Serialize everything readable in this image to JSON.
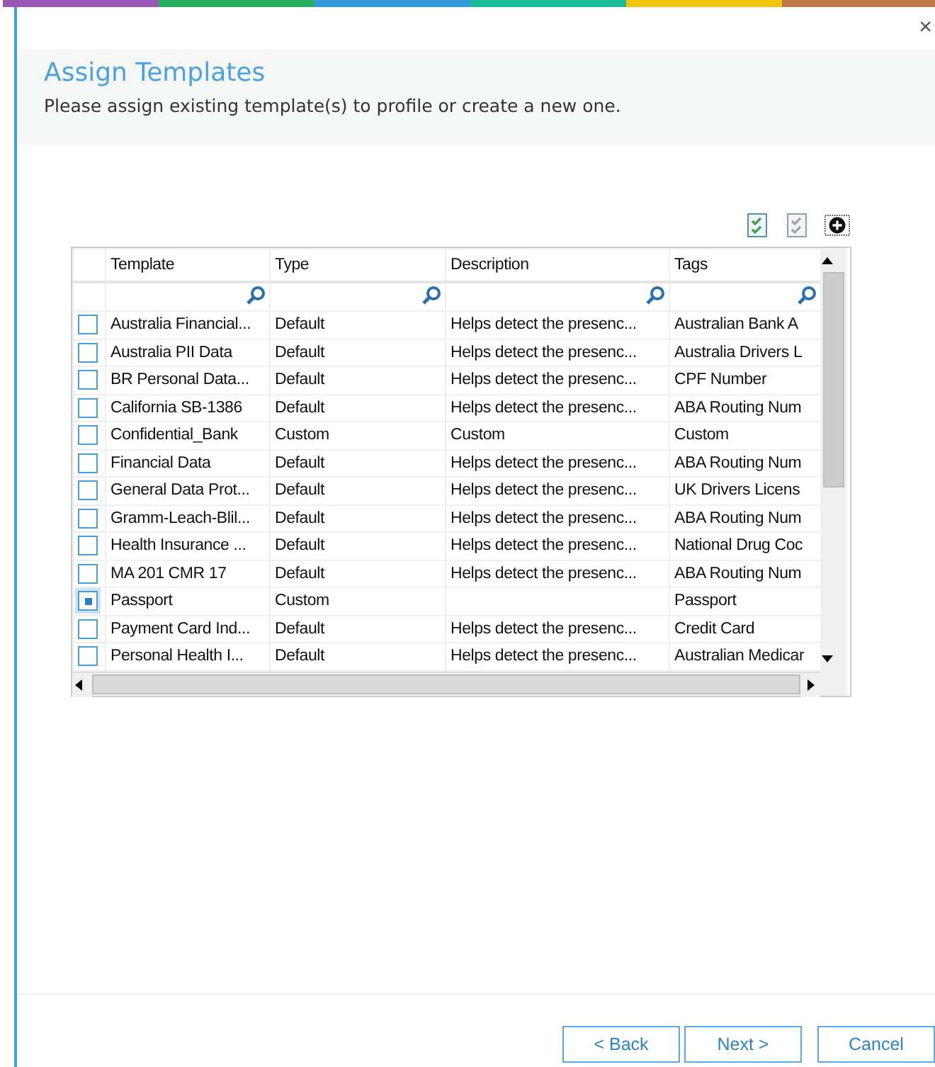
{
  "window": {
    "close": "×"
  },
  "header": {
    "title": "Assign Templates",
    "subtitle": "Please assign existing template(s) to profile or create a new one."
  },
  "table": {
    "columns": [
      "Template",
      "Type",
      "Description",
      "Tags"
    ],
    "rows": [
      {
        "checked": false,
        "cells": [
          "Australia Financial...",
          "Default",
          "Helps detect the presenc...",
          "Australian Bank A"
        ]
      },
      {
        "checked": false,
        "cells": [
          "Australia PII Data",
          "Default",
          "Helps detect the presenc...",
          "Australia Drivers L"
        ]
      },
      {
        "checked": false,
        "cells": [
          "BR Personal Data...",
          "Default",
          "Helps detect the presenc...",
          "CPF Number"
        ]
      },
      {
        "checked": false,
        "cells": [
          "California SB-1386",
          "Default",
          "Helps detect the presenc...",
          "ABA Routing Num"
        ]
      },
      {
        "checked": false,
        "cells": [
          "Confidential_Bank",
          "Custom",
          "Custom",
          "Custom"
        ]
      },
      {
        "checked": false,
        "cells": [
          "Financial Data",
          "Default",
          "Helps detect the presenc...",
          "ABA Routing Num"
        ]
      },
      {
        "checked": false,
        "cells": [
          "General Data Prot...",
          "Default",
          "Helps detect the presenc...",
          "UK Drivers Licens"
        ]
      },
      {
        "checked": false,
        "cells": [
          "Gramm-Leach-Blil...",
          "Default",
          "Helps detect the presenc...",
          "ABA Routing Num"
        ]
      },
      {
        "checked": false,
        "cells": [
          "Health Insurance ...",
          "Default",
          "Helps detect the presenc...",
          "National Drug Coc"
        ]
      },
      {
        "checked": false,
        "cells": [
          "MA 201 CMR 17",
          "Default",
          "Helps detect the presenc...",
          "ABA Routing Num"
        ]
      },
      {
        "checked": true,
        "cells": [
          "Passport",
          "Custom",
          "",
          "Passport"
        ]
      },
      {
        "checked": false,
        "cells": [
          "Payment Card Ind...",
          "Default",
          "Helps detect the presenc...",
          "Credit Card"
        ]
      },
      {
        "checked": false,
        "cells": [
          "Personal Health I...",
          "Default",
          "Helps detect the presenc...",
          "Australian Medicar"
        ]
      }
    ]
  },
  "buttons": [
    {
      "label": "< Back"
    },
    {
      "label": "Next >"
    },
    {
      "label": "Cancel"
    }
  ]
}
